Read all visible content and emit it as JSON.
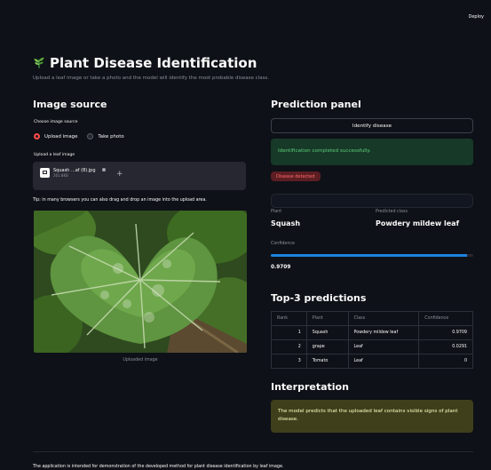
{
  "header": {
    "deploy_label": "Deploy"
  },
  "page": {
    "title": "Plant Disease Identification",
    "subtitle": "Upload a leaf image or take a photo and the model will identify the most probable disease class."
  },
  "image_source": {
    "heading": "Image source",
    "choose_label": "Choose image source",
    "options": [
      "Upload image",
      "Take photo"
    ],
    "selected": "Upload image",
    "upload_label": "Upload a leaf image",
    "file_name": "Squash ...af (8).jpg",
    "file_size": "261.8KB",
    "tip": "Tip: in many browsers you can also drag and drop an image into the upload area.",
    "caption": "Uploaded image"
  },
  "prediction": {
    "heading": "Prediction panel",
    "button_label": "Identify disease",
    "success_message": "Identification completed successfully.",
    "badge": "Disease detected",
    "plant_label": "Plant",
    "plant_value": "Squash",
    "class_label": "Predicted class",
    "class_value": "Powdery mildew leaf",
    "confidence_label": "Confidence",
    "confidence_value": "0.9709",
    "confidence_fraction": 0.9709
  },
  "top3": {
    "heading": "Top-3 predictions",
    "columns": [
      "Rank",
      "Plant",
      "Class",
      "Confidence"
    ],
    "rows": [
      {
        "rank": "1",
        "plant": "Squash",
        "class": "Powdery mildew leaf",
        "confidence": "0.9709"
      },
      {
        "rank": "2",
        "plant": "grape",
        "class": "Leaf",
        "confidence": "0.0291"
      },
      {
        "rank": "3",
        "plant": "Tomato",
        "class": "Leaf",
        "confidence": "0"
      }
    ]
  },
  "interpretation": {
    "heading": "Interpretation",
    "text": "The model predicts that the uploaded leaf contains visible signs of plant disease."
  },
  "footer": {
    "text": "The application is intended for demonstration of the developed method for plant disease identification by leaf image."
  },
  "colors": {
    "accent": "#ff4b4b",
    "progress": "#1c83e1",
    "success": "#5dd07a",
    "background": "#0e1117"
  }
}
